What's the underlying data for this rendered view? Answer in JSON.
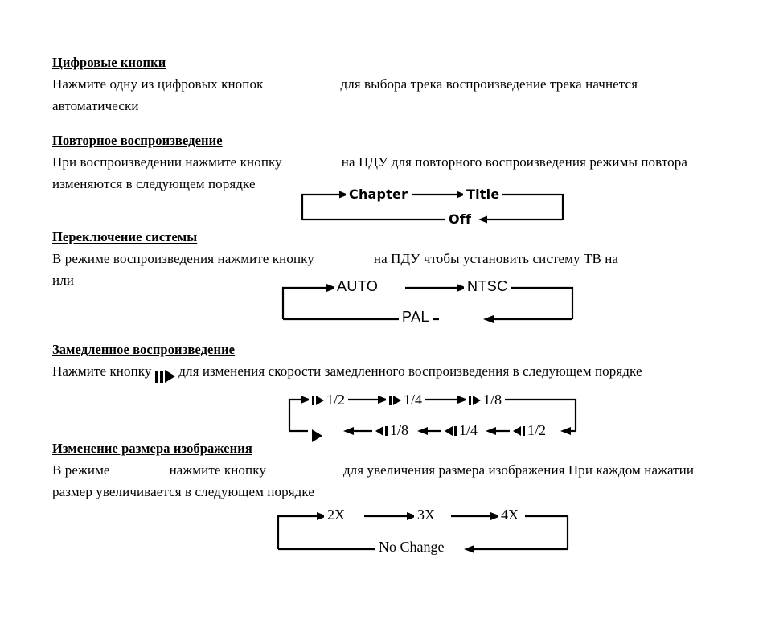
{
  "document": {
    "language": "ru",
    "page_background": "#ffffff",
    "text_color": "#000000"
  },
  "sections": [
    {
      "id": "numeric-buttons",
      "heading": "Цифровые кнопки",
      "paragraph_part1": "Нажмите  одну  из  цифровых  кнопок",
      "paragraph_part2": "для  выбора  трека   воспроизведение  трека  начнется",
      "paragraph_line2": "автоматически"
    },
    {
      "id": "repeat-playback",
      "heading": "Повторное воспроизведение",
      "paragraph_part1": "При воспроизведении нажмите кнопку",
      "paragraph_part2": "на ПДУ для повторного воспроизведения  режимы повтора",
      "paragraph_line2": "изменяются в следующем порядке"
    },
    {
      "id": "system-switch",
      "heading": "Переключение системы",
      "paragraph_part1": "В режиме воспроизведения нажмите кнопку",
      "paragraph_part2": "на ПДУ  чтобы установить систему ТВ на",
      "paragraph_line2": "или"
    },
    {
      "id": "slow-playback",
      "heading": "Замедленное воспроизведение",
      "paragraph_part1": "Нажмите кнопку",
      "paragraph_icon": "pause-play-icon",
      "paragraph_part2": "для изменения скорости замедленного воспроизведения в следующем порядке"
    },
    {
      "id": "image-zoom",
      "heading": "Изменение размера изображения",
      "paragraph_part1": "В режиме",
      "paragraph_part2": "нажмите кнопку",
      "paragraph_part3": "для увеличения размера изображения  При каждом нажатии",
      "paragraph_line2": "размер увеличивается в следующем порядке"
    }
  ],
  "diagrams": {
    "repeat_cycle": {
      "name": "repeat-mode-cycle",
      "style": "bold-sans",
      "nodes": [
        "Chapter",
        "Title",
        "Off"
      ],
      "flow": "Chapter → Title → Off → Chapter"
    },
    "tv_system_cycle": {
      "name": "tv-system-cycle",
      "style": "sans",
      "nodes": [
        "AUTO",
        "NTSC",
        "PAL"
      ],
      "flow": "AUTO → NTSC → PAL → AUTO"
    },
    "slow_speed_cycle": {
      "name": "slow-speed-cycle",
      "style": "serif",
      "nodes_forward": [
        "1/2",
        "1/4",
        "1/8"
      ],
      "nodes_reverse": [
        "1/8",
        "1/4",
        "1/2"
      ],
      "forward_icon": "step-forward-icon",
      "reverse_icon": "step-reverse-icon",
      "play_icon": "play-icon",
      "flow": "▐▶1/2 → ▐▶1/4 → ▐▶1/8 → ◀▌1/2 → ◀▌1/4 → ◀▌1/8 → ▶ → ▐▶1/2"
    },
    "zoom_cycle": {
      "name": "image-zoom-cycle",
      "style": "serif",
      "nodes": [
        "2X",
        "3X",
        "4X",
        "No Change"
      ],
      "flow": "2X → 3X → 4X → No Change → 2X"
    }
  }
}
